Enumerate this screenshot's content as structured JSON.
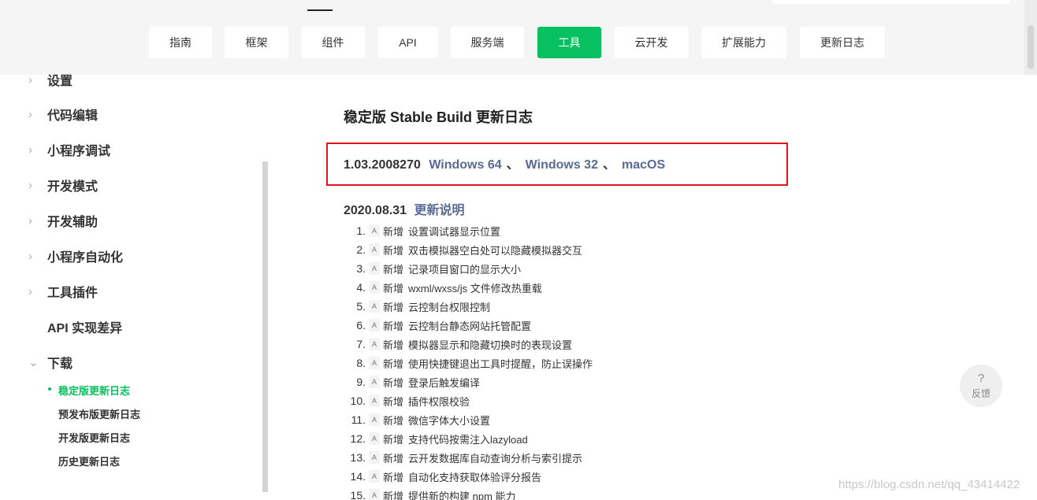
{
  "topnav": {
    "tabs": [
      {
        "label": "指南"
      },
      {
        "label": "框架"
      },
      {
        "label": "组件"
      },
      {
        "label": "API"
      },
      {
        "label": "服务端"
      },
      {
        "label": "工具",
        "active": true
      },
      {
        "label": "云开发"
      },
      {
        "label": "扩展能力"
      },
      {
        "label": "更新日志"
      }
    ],
    "accent_color": "#07c160"
  },
  "sidebar": {
    "items": [
      {
        "label": "设置",
        "expanded": false
      },
      {
        "label": "代码编辑",
        "expanded": false
      },
      {
        "label": "小程序调试",
        "expanded": false
      },
      {
        "label": "开发模式",
        "expanded": false
      },
      {
        "label": "开发辅助",
        "expanded": false
      },
      {
        "label": "小程序自动化",
        "expanded": false
      },
      {
        "label": "工具插件",
        "expanded": false
      },
      {
        "label": "API 实现差异"
      },
      {
        "label": "下载",
        "expanded": true
      }
    ],
    "download_children": [
      {
        "label": "稳定版更新日志",
        "active": true
      },
      {
        "label": "预发布版更新日志"
      },
      {
        "label": "开发版更新日志"
      },
      {
        "label": "历史更新日志"
      }
    ]
  },
  "content": {
    "title": "稳定版 Stable Build 更新日志",
    "version": "1.03.2008270",
    "downloads": [
      "Windows 64",
      "Windows 32",
      "macOS"
    ],
    "separator": "、",
    "date": "2020.08.31",
    "notes_link": "更新说明",
    "tag": "A",
    "kind": "新增",
    "entries": [
      "设置调试器显示位置",
      "双击模拟器空白处可以隐藏模拟器交互",
      "记录项目窗口的显示大小",
      "wxml/wxss/js 文件修改热重载",
      "云控制台权限控制",
      "云控制台静态网站托管配置",
      "模拟器显示和隐藏切换时的表现设置",
      "使用快捷键退出工具时提醒，防止误操作",
      "登录后触发编译",
      "插件权限校验",
      "微信字体大小设置",
      "支持代码按需注入lazyload",
      "云开发数据库自动查询分析与索引提示",
      "自动化支持获取体验评分报告",
      "提供新的构建 npm 能力"
    ]
  },
  "feedback": {
    "icon": "?",
    "label": "反馈"
  },
  "watermark": "https://blog.csdn.net/qq_43414422"
}
